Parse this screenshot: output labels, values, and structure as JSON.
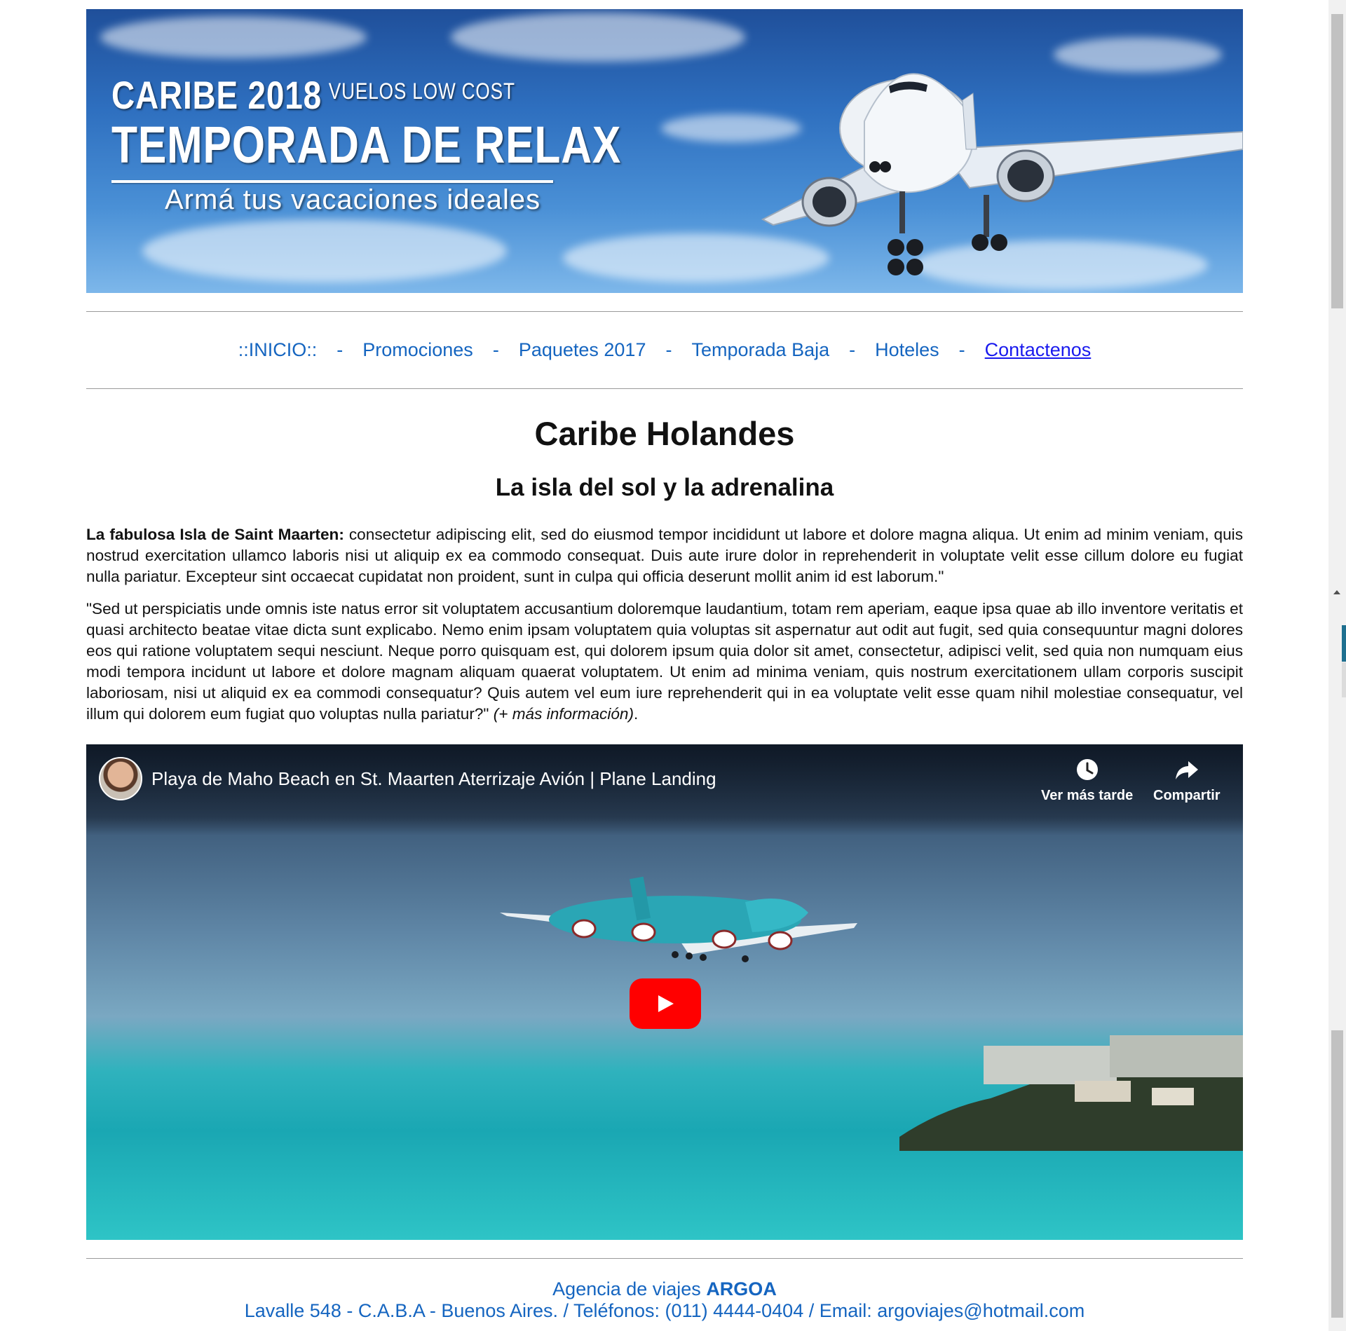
{
  "banner": {
    "line1": "CARIBE 2018",
    "line1_sub": "VUELOS LOW COST",
    "line2": "TEMPORADA DE RELAX",
    "line3": "Armá tus vacaciones ideales"
  },
  "nav": {
    "items": [
      {
        "label": "::INICIO::"
      },
      {
        "label": "Promociones"
      },
      {
        "label": "Paquetes 2017"
      },
      {
        "label": "Temporada Baja"
      },
      {
        "label": "Hoteles"
      },
      {
        "label": "Contactenos"
      }
    ],
    "separator": "-"
  },
  "article": {
    "title": "Caribe Holandes",
    "subtitle": "La isla del sol y la adrenalina",
    "p1_bold": "La fabulosa Isla de Saint Maarten:",
    "p1_text": " consectetur adipiscing elit, sed do eiusmod tempor incididunt ut labore et dolore magna aliqua. Ut enim ad minim veniam, quis nostrud exercitation ullamco laboris nisi ut aliquip ex ea commodo consequat. Duis aute irure dolor in reprehenderit in voluptate velit esse cillum dolore eu fugiat nulla pariatur. Excepteur sint occaecat cupidatat non proident, sunt in culpa qui officia deserunt mollit anim id est laborum.\"",
    "p2_text": "\"Sed ut perspiciatis unde omnis iste natus error sit voluptatem accusantium doloremque laudantium, totam rem aperiam, eaque ipsa quae ab illo inventore veritatis et quasi architecto beatae vitae dicta sunt explicabo. Nemo enim ipsam voluptatem quia voluptas sit aspernatur aut odit aut fugit, sed quia consequuntur magni dolores eos qui ratione voluptatem sequi nesciunt. Neque porro quisquam est, qui dolorem ipsum quia dolor sit amet, consectetur, adipisci velit, sed quia non numquam eius modi tempora incidunt ut labore et dolore magnam aliquam quaerat voluptatem. Ut enim ad minima veniam, quis nostrum exercitationem ullam corporis suscipit laboriosam, nisi ut aliquid ex ea commodi consequatur? Quis autem vel eum iure reprehenderit qui in ea voluptate velit esse quam nihil molestiae consequatur, vel illum qui dolorem eum fugiat quo voluptas nulla pariatur?\" ",
    "p2_more": "(+ más información)",
    "p2_end": "."
  },
  "video": {
    "title": "Playa de Maho Beach en St. Maarten Aterrizaje Avión | Plane Landing",
    "watch_later": "Ver más tarde",
    "share": "Compartir"
  },
  "footer": {
    "line1_prefix": "Agencia de viajes ",
    "line1_brand": "ARGOA",
    "line2": "Lavalle 548 - C.A.B.A - Buenos Aires. / Teléfonos: (011) 4444-0404 / Email: argoviajes@hotmail.com"
  },
  "colors": {
    "link": "#1565c0",
    "active_link": "#1a1aee",
    "play_button": "#ff0000"
  }
}
